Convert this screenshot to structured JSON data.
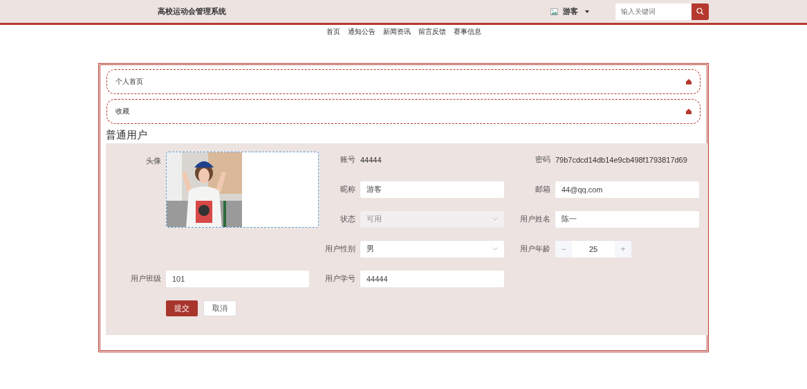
{
  "header": {
    "title": "高校运动会管理系统",
    "user": "游客",
    "search": {
      "placeholder": "输入关键词"
    }
  },
  "nav": [
    "首页",
    "通知公告",
    "新闻资讯",
    "留言反馈",
    "赛事信息"
  ],
  "menu": [
    {
      "label": "个人首页"
    },
    {
      "label": "收藏"
    }
  ],
  "section_title": "普通用户",
  "form": [
    {
      "kind": "avatar",
      "label": "头像"
    },
    {
      "kind": "text",
      "label": "账号",
      "value": "44444"
    },
    {
      "kind": "text",
      "label": "密码",
      "value": "79b7cdcd14db14e9cb498f1793817d69"
    },
    {
      "kind": "input",
      "label": "昵称",
      "value": "游客"
    },
    {
      "kind": "input",
      "label": "邮箱",
      "value": "44@qq.com"
    },
    {
      "kind": "select",
      "label": "状态",
      "value": "可用",
      "disabled": true
    },
    {
      "kind": "input",
      "label": "用户姓名",
      "value": "陈一"
    },
    {
      "kind": "select",
      "label": "用户性别",
      "value": "男",
      "disabled": false
    },
    {
      "kind": "number",
      "label": "用户年龄",
      "value": "25",
      "minus": "−",
      "plus": "+"
    },
    {
      "kind": "input",
      "label": "用户班级",
      "value": "101"
    },
    {
      "kind": "input",
      "label": "用户学号",
      "value": "44444"
    }
  ],
  "buttons": [
    {
      "label": "提交",
      "primary": true
    },
    {
      "label": "取消",
      "primary": false
    }
  ]
}
